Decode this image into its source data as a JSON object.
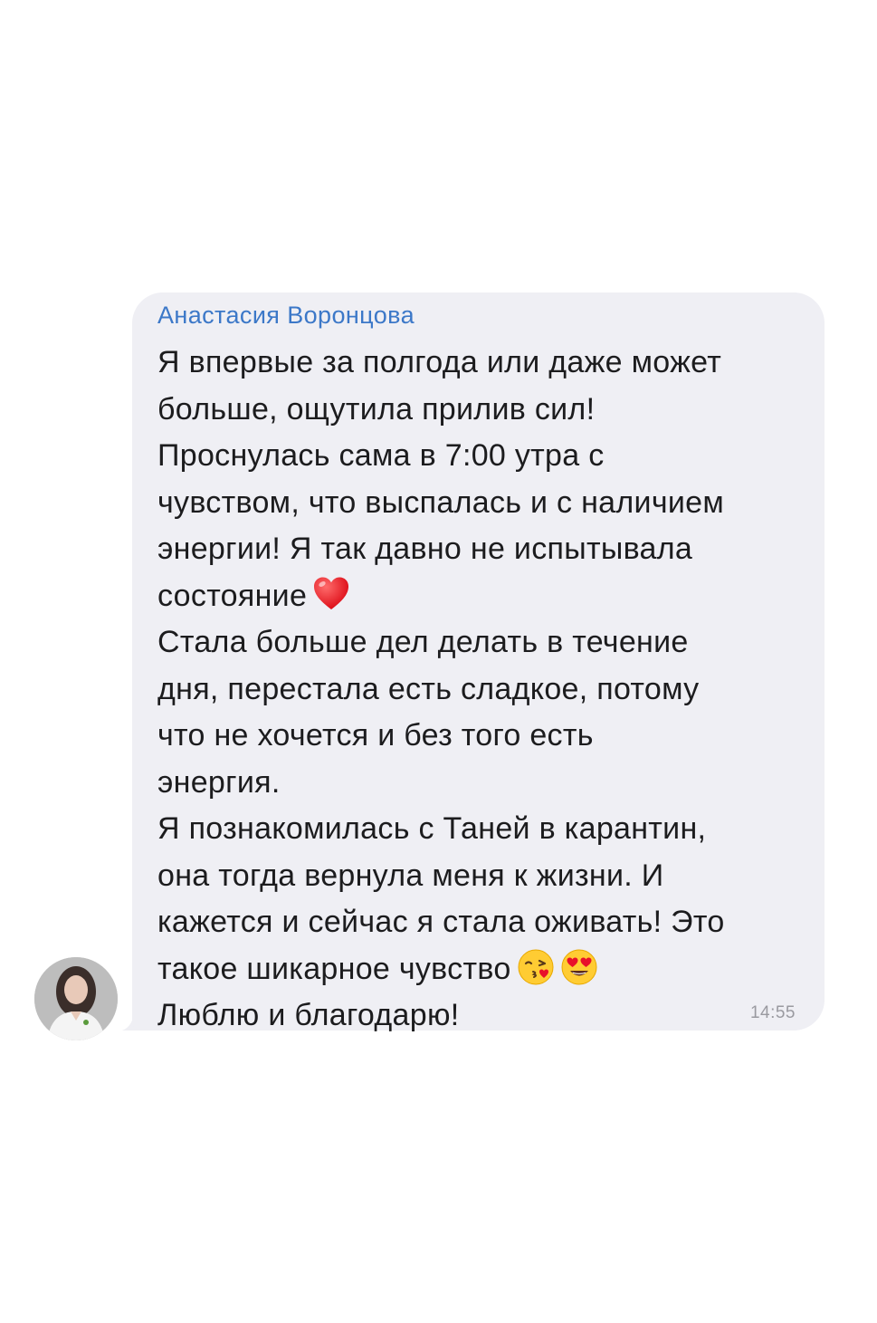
{
  "message": {
    "sender_name": "Анастасия Воронцова",
    "lines": [
      "Я впервые за полгода или даже может",
      "больше, ощутила прилив сил!",
      "Проснулась сама в 7:00 утра с",
      "чувством, что выспалась и с наличием",
      "энергии! Я так давно не испытывала",
      "состояние",
      "Стала больше дел делать в течение",
      "дня, перестала есть сладкое, потому",
      "что не хочется и без того есть",
      "энергия.",
      "Я познакомилась с Таней в карантин,",
      "она тогда вернула меня к жизни. И",
      "кажется и сейчас я стала оживать! Это",
      "такое шикарное чувство",
      "Люблю и благодарю!"
    ],
    "time": "14:55",
    "emojis": [
      "heart-emoji",
      "kissing-face-emoji",
      "heart-eyes-emoji"
    ]
  },
  "colors": {
    "bubble": "#efeff4",
    "sender": "#3c78c8",
    "text": "#1c1c1e",
    "timestamp": "#9a9aa0"
  }
}
